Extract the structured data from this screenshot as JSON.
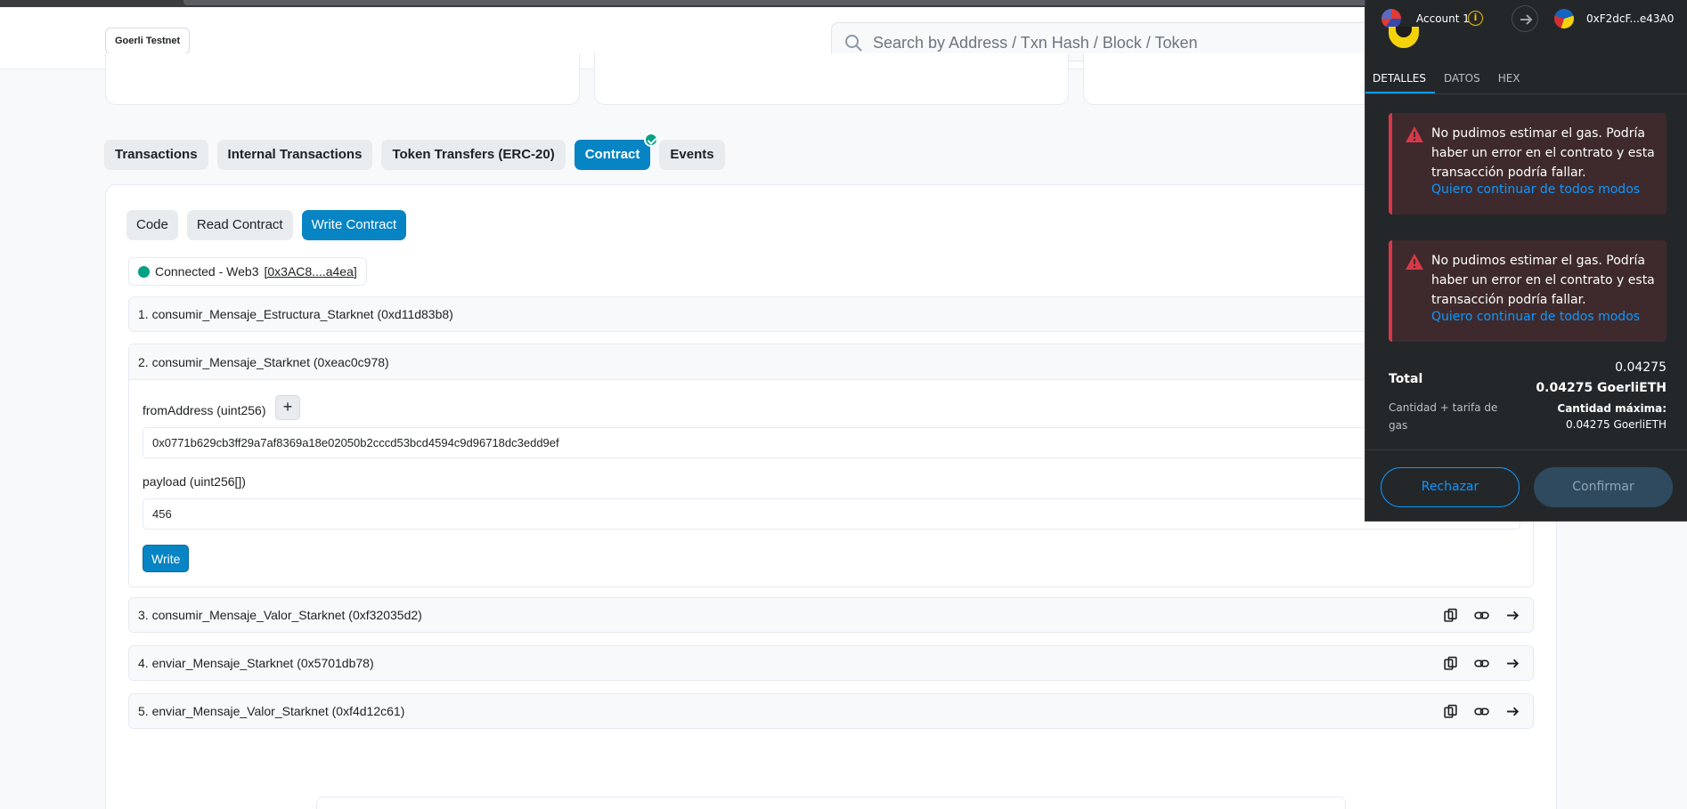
{
  "header": {
    "network": "Goerli Testnet",
    "search_placeholder": "Search by Address / Txn Hash / Block / Token"
  },
  "tabs": [
    {
      "label": "Transactions"
    },
    {
      "label": "Internal Transactions"
    },
    {
      "label": "Token Transfers (ERC-20)"
    },
    {
      "label": "Contract",
      "active": true,
      "verified": true
    },
    {
      "label": "Events"
    }
  ],
  "sub_tabs": [
    {
      "label": "Code"
    },
    {
      "label": "Read Contract"
    },
    {
      "label": "Write Contract",
      "active": true
    }
  ],
  "connection": {
    "status": "Connected - Web3",
    "address": "[0x3AC8....a4ea]",
    "status_color": "#00a186"
  },
  "functions": [
    {
      "label": "1. consumir_Mensaje_Estructura_Starknet (0xd11d83b8)"
    },
    {
      "label": "2. consumir_Mensaje_Starknet (0xeac0c978)",
      "expanded": true,
      "params": [
        {
          "label": "fromAddress (uint256)",
          "value": "0x0771b629cb3ff29a7af8369a18e02050b2cccd53bcd4594c9d96718dc3edd9ef"
        },
        {
          "label": "payload (uint256[])",
          "value": "456"
        }
      ],
      "write_label": "Write",
      "plus_label": "+"
    },
    {
      "label": "3. consumir_Mensaje_Valor_Starknet (0xf32035d2)"
    },
    {
      "label": "4. enviar_Mensaje_Starknet (0x5701db78)"
    },
    {
      "label": "5. enviar_Mensaje_Valor_Starknet (0xf4d12c61)"
    }
  ],
  "metamask": {
    "account": "Account 1",
    "destination": "0xF2dcF...e43A0",
    "tabs": [
      {
        "label": "DETALLES",
        "active": true
      },
      {
        "label": "DATOS"
      },
      {
        "label": "HEX"
      }
    ],
    "alerts": [
      {
        "message": "No pudimos estimar el gas. Podría haber un error en el contrato y esta transacción podría fallar.",
        "link": "Quiero continuar de todos modos"
      },
      {
        "message": "No pudimos estimar el gas. Podría haber un error en el contrato y esta transacción podría fallar.",
        "link": "Quiero continuar de todos modos"
      }
    ],
    "total": {
      "label": "Total",
      "amount": "0.04275",
      "amount_currency": "0.04275 GoerliETH",
      "subtitle": "Cantidad + tarifa de gas",
      "max_label": "Cantidad máxima:",
      "max_value": "0.04275 GoerliETH"
    },
    "reject_label": "Rechazar",
    "confirm_label": "Confirmar",
    "accent_color": "#1098fc",
    "error_color": "#d73847"
  }
}
